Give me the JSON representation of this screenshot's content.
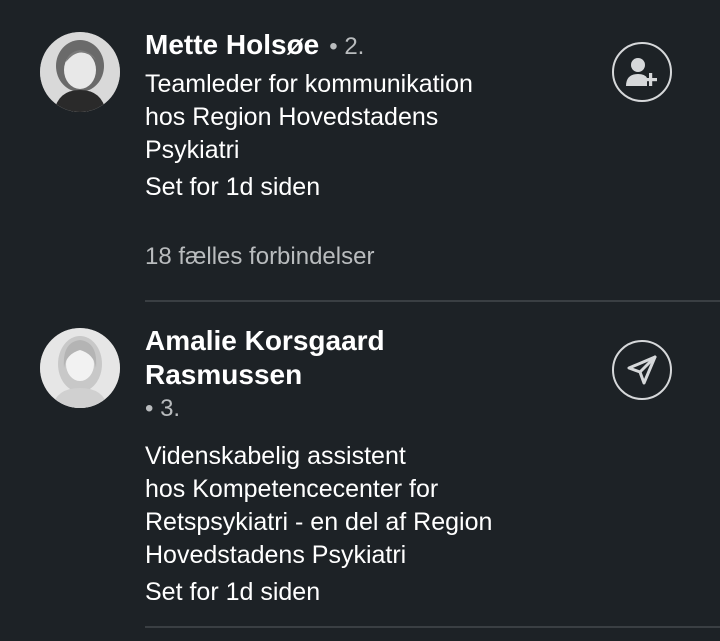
{
  "people": [
    {
      "name_lines": [
        "Mette Holsøe"
      ],
      "degree": "• 2.",
      "headline_lines": [
        "Teamleder for kommunikation",
        "hos Region Hovedstadens",
        "Psykiatri"
      ],
      "seen": "Set for 1d siden",
      "mutual": "18 fælles forbindelser",
      "action_icon": "connect-icon"
    },
    {
      "name_lines": [
        "Amalie Korsgaard",
        "Rasmussen"
      ],
      "degree": "• 3.",
      "headline_lines": [
        "Videnskabelig assistent",
        "hos Kompetencecenter for",
        "Retspsykiatri - en del af Region",
        "Hovedstadens Psykiatri"
      ],
      "seen": "Set for 1d siden",
      "action_icon": "send-message-icon"
    }
  ],
  "colors": {
    "background": "#1d2226",
    "primary_text": "#ffffff",
    "secondary_text": "#b9bcbe",
    "divider": "#3a3f43",
    "icon_stroke": "#d6d8da"
  }
}
